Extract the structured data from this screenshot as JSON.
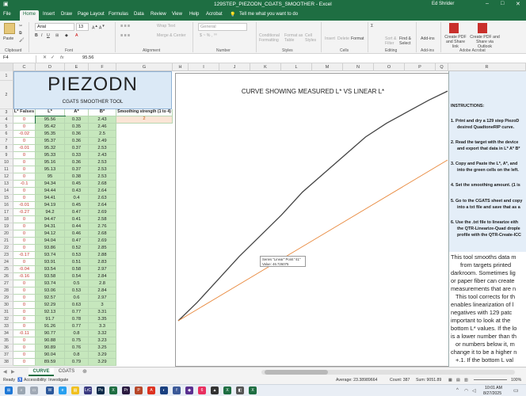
{
  "window": {
    "title": "129STEP_PIEZODN_CGATS_SMOOTHER - Excel",
    "user": "Ed Shrider"
  },
  "ribbon_tabs": [
    "File",
    "Home",
    "Insert",
    "Draw",
    "Page Layout",
    "Formulas",
    "Data",
    "Review",
    "View",
    "Help",
    "Acrobat"
  ],
  "tell_me": "Tell me what you want to do",
  "ribbon": {
    "paste": "Paste",
    "font_name": "Arial",
    "font_size": "13",
    "wrap_text": "Wrap Text",
    "merge_center": "Merge & Center",
    "number_format": "General",
    "conditional_formatting": "Conditional Formatting",
    "format_as_table": "Format as Table",
    "cell_styles": "Cell Styles",
    "insert": "Insert",
    "delete": "Delete",
    "format": "Format",
    "sort_filter": "Sort & Filter",
    "find_select": "Find & Select",
    "addins": "Add-ins",
    "create_pdf": "Create PDF and Share link",
    "create_pdf_outlook": "Create PDF and Share via Outlook",
    "groups": [
      "Clipboard",
      "Font",
      "Alignment",
      "Number",
      "Styles",
      "Cells",
      "Editing",
      "Add-ins",
      "Adobe Acrobat"
    ]
  },
  "formula_bar": {
    "name_box": "F4",
    "value": "95.56"
  },
  "columns": [
    "C",
    "D",
    "E",
    "F",
    "G",
    "H",
    "I",
    "J",
    "K",
    "L",
    "M",
    "N",
    "O",
    "P",
    "Q",
    "R"
  ],
  "sheet": {
    "big_title": "PIEZODN",
    "subtitle": "CGATS SMOOTHER TOOL",
    "headers": [
      "L* Falses",
      "L*",
      "A*",
      "B*",
      "Smoothing strength (1 to 4)"
    ],
    "smoothing_value": "2",
    "rows": [
      [
        "0",
        "95.56",
        "0.33",
        "2.43"
      ],
      [
        "0",
        "95.42",
        "0.35",
        "2.46"
      ],
      [
        "-0.02",
        "95.35",
        "0.36",
        "2.5"
      ],
      [
        "0",
        "95.37",
        "0.36",
        "2.49"
      ],
      [
        "-0.01",
        "95.32",
        "0.37",
        "2.53"
      ],
      [
        "0",
        "95.33",
        "0.33",
        "2.43"
      ],
      [
        "0",
        "95.16",
        "0.36",
        "2.53"
      ],
      [
        "0",
        "95.13",
        "0.37",
        "2.53"
      ],
      [
        "0",
        "95",
        "0.38",
        "2.53"
      ],
      [
        "-0.1",
        "94.34",
        "0.45",
        "2.68"
      ],
      [
        "0",
        "94.44",
        "0.43",
        "2.64"
      ],
      [
        "0",
        "94.41",
        "0.4",
        "2.63"
      ],
      [
        "-0.01",
        "94.19",
        "0.45",
        "2.64"
      ],
      [
        "-0.27",
        "94.2",
        "0.47",
        "2.69"
      ],
      [
        "0",
        "94.47",
        "0.41",
        "2.58"
      ],
      [
        "0",
        "94.31",
        "0.44",
        "2.76"
      ],
      [
        "0",
        "94.12",
        "0.46",
        "2.68"
      ],
      [
        "0",
        "94.04",
        "0.47",
        "2.69"
      ],
      [
        "0",
        "93.86",
        "0.52",
        "2.85"
      ],
      [
        "-0.17",
        "93.74",
        "0.53",
        "2.88"
      ],
      [
        "0",
        "93.91",
        "0.51",
        "2.83"
      ],
      [
        "-0.04",
        "93.54",
        "0.58",
        "2.97"
      ],
      [
        "-0.16",
        "93.58",
        "0.54",
        "2.84"
      ],
      [
        "0",
        "93.74",
        "0.5",
        "2.8"
      ],
      [
        "0",
        "93.06",
        "0.53",
        "2.84"
      ],
      [
        "0",
        "92.57",
        "0.6",
        "2.97"
      ],
      [
        "0",
        "92.29",
        "0.63",
        "3"
      ],
      [
        "0",
        "92.13",
        "0.77",
        "3.31"
      ],
      [
        "0",
        "91.7",
        "0.78",
        "3.35"
      ],
      [
        "0",
        "91.26",
        "0.77",
        "3.3"
      ],
      [
        "-0.11",
        "90.77",
        "0.8",
        "3.32"
      ],
      [
        "0",
        "90.88",
        "0.75",
        "3.23"
      ],
      [
        "0",
        "90.89",
        "0.76",
        "3.25"
      ],
      [
        "0",
        "90.04",
        "0.8",
        "3.29"
      ],
      [
        "0",
        "89.59",
        "0.79",
        "3.29"
      ]
    ],
    "row_numbers": [
      "1",
      "2",
      "3",
      "4",
      "5",
      "6",
      "7",
      "8",
      "9",
      "10",
      "11",
      "12",
      "13",
      "14",
      "15",
      "16",
      "17",
      "18",
      "19",
      "20",
      "21",
      "22",
      "23",
      "24",
      "25",
      "26",
      "27",
      "28",
      "29",
      "30",
      "31",
      "32",
      "33",
      "34",
      "35",
      "36",
      "37",
      "38"
    ]
  },
  "chart": {
    "title": "CURVE SHOWING MEASURED L* VS LINEAR L*",
    "tooltip_line1": "Series \"Linear\" Point \"41\"",
    "tooltip_line2": "Value: 46.726075"
  },
  "chart_data": {
    "type": "line",
    "title": "CURVE SHOWING MEASURED L* VS LINEAR L*",
    "xlabel": "",
    "ylabel": "",
    "grid": false,
    "legend": "none",
    "x_points": 129,
    "series": [
      {
        "color": "#444444",
        "x": [
          1,
          10,
          20,
          30,
          40,
          50,
          60,
          70,
          80,
          90,
          100,
          110,
          120,
          129
        ],
        "values": [
          0,
          8,
          18,
          28,
          37,
          46,
          56,
          64,
          72,
          80,
          86,
          91,
          96,
          100
        ]
      },
      {
        "color": "#e8873a",
        "x": [
          1,
          129
        ],
        "values": [
          0,
          70
        ]
      }
    ]
  },
  "instructions": {
    "heading": "INSTRUCTIONS:",
    "steps": [
      "1. Print and dry a 129 step PiezoD",
      "desired QuadtoneRIP curve.",
      "2. Read the target with the device",
      "and export that data in L* A* B*",
      "3. Copy and Paste the L*, A*, and",
      "into the green cells on the left.",
      "4. Set the smoothing amount. (1 is",
      "5. Go to the CGATS sheet and copy",
      "into a txt file and save that as a",
      "6. Use the .txt file to linearize eith",
      "the QTR-Linearize-Quad drople",
      "profile with the QTR-Create-ICC"
    ],
    "paragraph": [
      "This tool smooths data m",
      "from targets printed",
      "darkroom. Sometimes lig",
      "or paper fiber can create",
      "measurements that are n",
      "This tool corrects for th",
      "enables linearization of l",
      "negatives with 129 patc",
      "important to look at the",
      "bottom L* values. If the lo",
      "is a lower number than th",
      "or numbers below it, m",
      "change it to be a higher n",
      "+.1. If the bottom L val"
    ]
  },
  "sheet_tabs": [
    "CURVE",
    "CGATS"
  ],
  "status": {
    "ready": "Ready",
    "accessibility": "Accessibility: Investigate",
    "average": "Average: 23.38989664",
    "count": "Count: 387",
    "sum": "Sum: 9051.89",
    "zoom": "100%"
  },
  "taskbar": {
    "time": "10:01 AM",
    "date": "8/27/2025"
  }
}
